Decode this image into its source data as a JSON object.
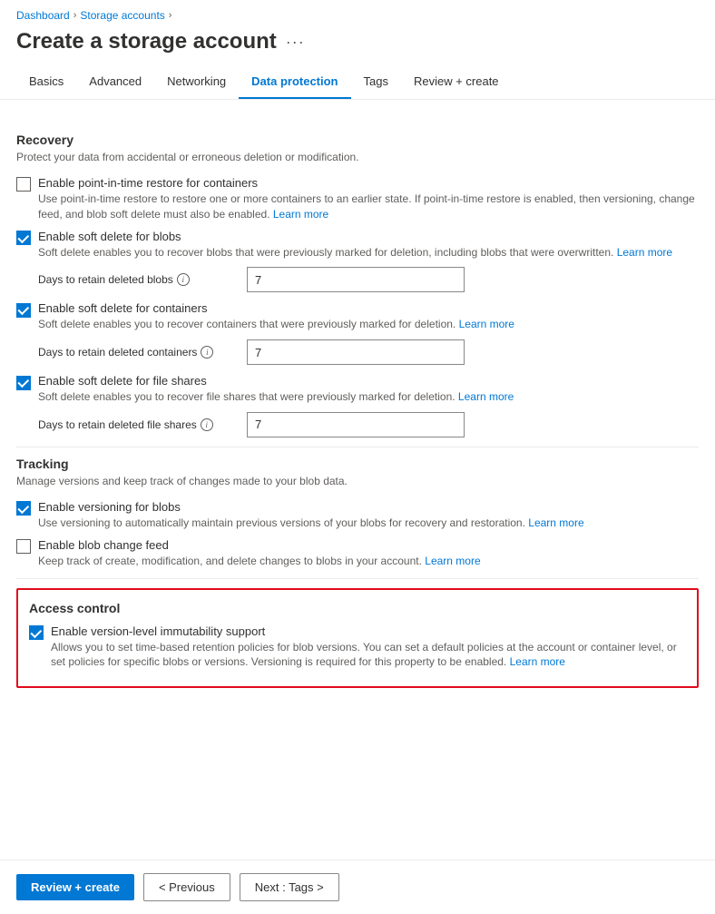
{
  "breadcrumb": {
    "dashboard": "Dashboard",
    "storage_accounts": "Storage accounts"
  },
  "page": {
    "title": "Create a storage account",
    "dots": "···"
  },
  "tabs": [
    {
      "id": "basics",
      "label": "Basics",
      "active": false
    },
    {
      "id": "advanced",
      "label": "Advanced",
      "active": false
    },
    {
      "id": "networking",
      "label": "Networking",
      "active": false
    },
    {
      "id": "data_protection",
      "label": "Data protection",
      "active": true
    },
    {
      "id": "tags",
      "label": "Tags",
      "active": false
    },
    {
      "id": "review_create",
      "label": "Review + create",
      "active": false
    }
  ],
  "sections": {
    "recovery": {
      "title": "Recovery",
      "desc": "Protect your data from accidental or erroneous deletion or modification.",
      "items": [
        {
          "id": "point_in_time",
          "label": "Enable point-in-time restore for containers",
          "desc": "Use point-in-time restore to restore one or more containers to an earlier state. If point-in-time restore is enabled, then versioning, change feed, and blob soft delete must also be enabled.",
          "link_text": "Learn more",
          "checked": false,
          "has_field": false
        },
        {
          "id": "soft_delete_blobs",
          "label": "Enable soft delete for blobs",
          "desc": "Soft delete enables you to recover blobs that were previously marked for deletion, including blobs that were overwritten.",
          "link_text": "Learn more",
          "checked": true,
          "has_field": true,
          "field_label": "Days to retain deleted blobs",
          "field_value": "7"
        },
        {
          "id": "soft_delete_containers",
          "label": "Enable soft delete for containers",
          "desc": "Soft delete enables you to recover containers that were previously marked for deletion.",
          "link_text": "Learn more",
          "checked": true,
          "has_field": true,
          "field_label": "Days to retain deleted containers",
          "field_value": "7"
        },
        {
          "id": "soft_delete_file_shares",
          "label": "Enable soft delete for file shares",
          "desc": "Soft delete enables you to recover file shares that were previously marked for deletion.",
          "link_text": "Learn more",
          "checked": true,
          "has_field": true,
          "field_label": "Days to retain deleted file shares",
          "field_value": "7"
        }
      ]
    },
    "tracking": {
      "title": "Tracking",
      "desc": "Manage versions and keep track of changes made to your blob data.",
      "items": [
        {
          "id": "versioning",
          "label": "Enable versioning for blobs",
          "desc": "Use versioning to automatically maintain previous versions of your blobs for recovery and restoration.",
          "link_text": "Learn more",
          "checked": true,
          "has_field": false
        },
        {
          "id": "blob_change_feed",
          "label": "Enable blob change feed",
          "desc": "Keep track of create, modification, and delete changes to blobs in your account.",
          "link_text": "Learn more",
          "checked": false,
          "has_field": false
        }
      ]
    },
    "access_control": {
      "title": "Access control",
      "items": [
        {
          "id": "immutability",
          "label": "Enable version-level immutability support",
          "desc": "Allows you to set time-based retention policies for blob versions. You can set a default policies at the account or container level, or set policies for specific blobs or versions. Versioning is required for this property to be enabled.",
          "link_text": "Learn more",
          "checked": true
        }
      ]
    }
  },
  "footer": {
    "review_create": "Review + create",
    "previous": "< Previous",
    "next": "Next : Tags >"
  }
}
